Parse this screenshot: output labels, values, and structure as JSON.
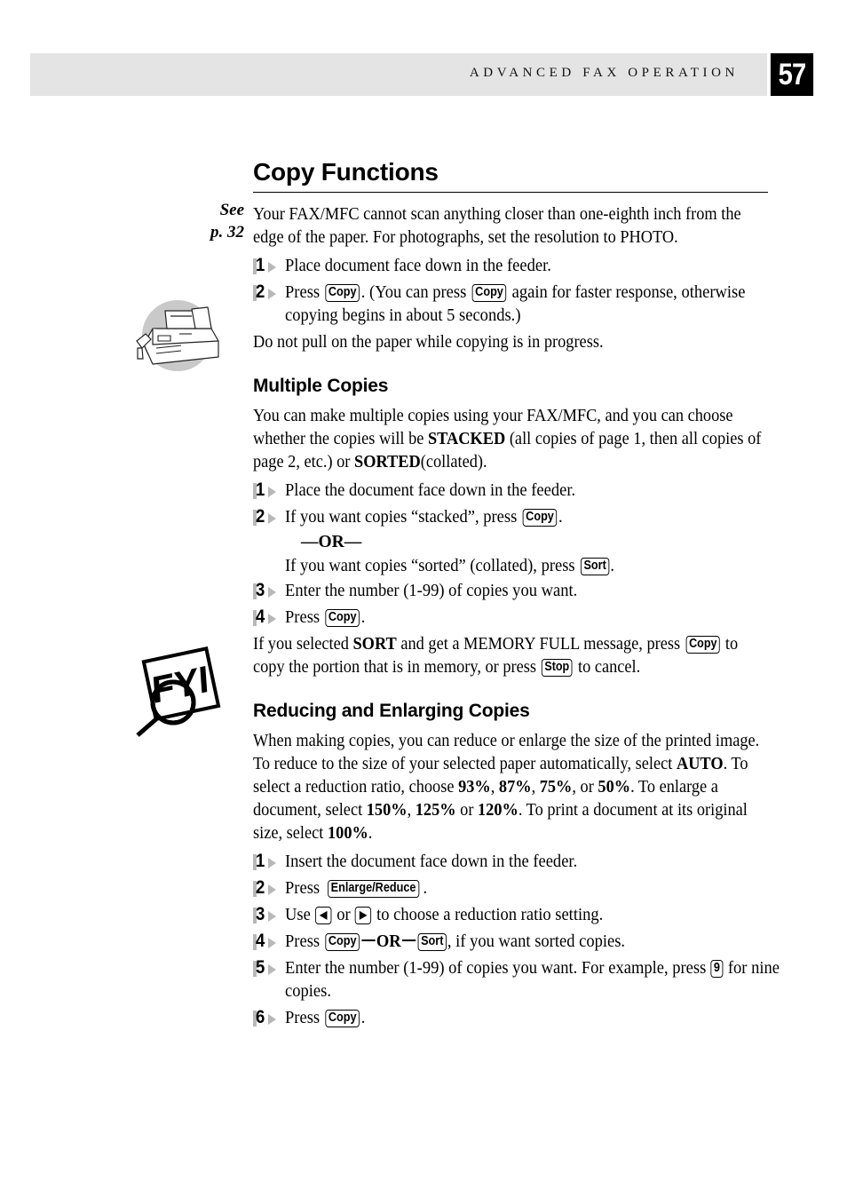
{
  "header": {
    "title": "ADVANCED FAX OPERATION",
    "page_number": "57"
  },
  "margin_notes": {
    "see_line1": "See",
    "see_line2": "p. 32"
  },
  "doc": {
    "title": "Copy Functions",
    "intro": "Your FAX/MFC cannot scan anything closer than one-eighth inch from the edge of the paper. For photographs, set the resolution to PHOTO.",
    "steps": [
      {
        "num": "1",
        "text": "Place document face down in the feeder."
      },
      {
        "num": "2",
        "text_a": "Press",
        "key_a": "Copy",
        "text_b": ". (You can press",
        "key_b": "Copy",
        "text_c": " again for faster response, otherwise copying begins in about 5 seconds.)"
      }
    ],
    "note": "Do not pull on the paper while copying is in progress."
  },
  "multiple_copies": {
    "title": "Multiple Copies",
    "intro_a": "You can make multiple copies using your FAX/MFC, and you can choose whether the copies will be ",
    "bold_stacked": "STACKED",
    "intro_b": " (all copies of page 1, then all copies of page 2, etc.) or ",
    "bold_sorted": "SORTED",
    "intro_c": "(collated).",
    "steps": [
      {
        "num": "1",
        "text": "Place the document face down in the feeder."
      },
      {
        "num": "2",
        "text_a": "If you want copies “stacked”, press",
        "key_a": "Copy",
        "text_b": "."
      },
      {
        "num": "3",
        "text": "Enter the number (1-99) of copies you want."
      },
      {
        "num": "4",
        "text_a": "Press",
        "key_a": "Copy",
        "text_b": "."
      }
    ],
    "or_label": "—OR—",
    "sorted_line_a": "If you want copies “sorted” (collated), press",
    "sorted_key": "Sort",
    "sorted_line_b": ".",
    "fyi_note_a": "If you selected ",
    "fyi_note_bold": "SORT",
    "fyi_note_b": " and get a MEMORY FULL message, press",
    "fyi_note_key1": "Copy",
    "fyi_note_c": " to copy the portion that is in memory, or press",
    "fyi_note_key2": "Stop",
    "fyi_note_d": " to cancel."
  },
  "reducing": {
    "title": "Reducing and Enlarging Copies",
    "intro_a": "When making copies, you can reduce or enlarge the size of the printed image.  To reduce to the size of your selected paper automatically, select ",
    "bold_auto": "AUTO",
    "intro_b": ".  To select a reduction ratio, choose ",
    "ratio_1": "93%",
    "ratio_sep1": ", ",
    "ratio_2": "87%",
    "ratio_sep2": ", ",
    "ratio_3": "75%",
    "ratio_sep3": ", or ",
    "ratio_4": "50%",
    "intro_c": ".  To enlarge a document, select ",
    "ratio_5": "150%",
    "ratio_sep4": ", ",
    "ratio_6": "125%",
    "ratio_sep5": " or ",
    "ratio_7": "120%",
    "intro_d": ".  To print a document at its original size, select ",
    "ratio_8": "100%",
    "intro_e": ".",
    "steps": [
      {
        "num": "1",
        "text": "Insert the document face down in the feeder."
      },
      {
        "num": "2",
        "text_a": "Press",
        "key_a": "Enlarge/Reduce",
        "text_b": "."
      },
      {
        "num": "3",
        "text_a": "Use",
        "key_left": "◀",
        "text_mid": "or",
        "key_right": "▶",
        "text_b": "to choose a reduction ratio setting."
      },
      {
        "num": "4",
        "text_a": "Press",
        "key_a": "Copy",
        "or": "OR",
        "key_b": "Sort",
        "text_b": ", if you want sorted copies."
      },
      {
        "num": "5",
        "text_a": "Enter the number (1-99) of copies you want. For example, press",
        "key_a": "9",
        "text_b": " for nine copies."
      },
      {
        "num": "6",
        "text_a": "Press",
        "key_a": "Copy",
        "text_b": "."
      }
    ]
  },
  "illustrations": {
    "fax_machine": "fax-machine-illustration",
    "fyi": "fyi-magnifier-illustration"
  },
  "colors": {
    "header_band": "#e4e4e4",
    "badge_bg": "#000000",
    "marker_gray": "#b8b8b8"
  }
}
